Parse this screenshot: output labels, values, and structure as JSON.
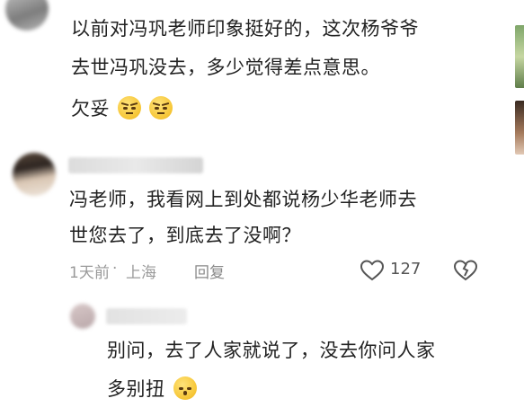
{
  "comment1": {
    "lines": [
      "以前对冯巩老师印象挺好的，这次杨爷爷",
      "去世冯巩没去，多少觉得差点意思。",
      "欠妥"
    ],
    "emojis": [
      "sulking-face-emoji",
      "sulking-face-emoji"
    ]
  },
  "comment2": {
    "lines": [
      "冯老师，我看网上到处都说杨少华老师去",
      "世您去了，到底去了没啊？"
    ],
    "time": "1天前",
    "separator": "·",
    "location": "上海",
    "reply_label": "回复",
    "like_count": "127"
  },
  "reply": {
    "lines": [
      "别问，去了人家就说了，没去你问人家",
      "多别扭"
    ],
    "emoji": "kissing-face-emoji"
  },
  "colors": {
    "text": "#222222",
    "meta": "#9a9a9a",
    "icon": "#555555"
  }
}
